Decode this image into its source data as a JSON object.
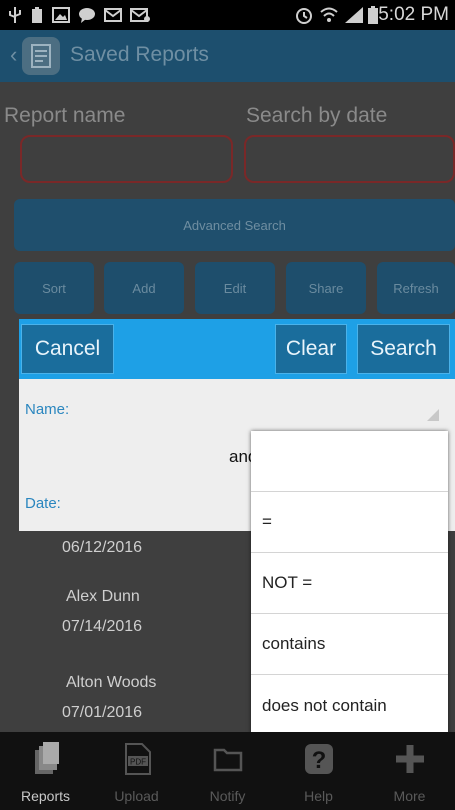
{
  "status_bar": {
    "time": "5:02 PM",
    "icons": [
      "usb-icon",
      "battery-notification-icon",
      "image-icon",
      "chat-icon",
      "gmail-icon",
      "mail-icon",
      "alarm-icon",
      "wifi-icon",
      "signal-icon",
      "battery-icon"
    ]
  },
  "action_bar": {
    "title": "Saved Reports",
    "icon": "report-icon"
  },
  "form": {
    "report_name_label": "Report name",
    "search_by_date_label": "Search by date",
    "report_name_value": "",
    "search_by_date_value": "",
    "advanced_search_label": "Advanced Search"
  },
  "toolbar": {
    "sort_label": "Sort",
    "add_label": "Add",
    "edit_label": "Edit",
    "share_label": "Share",
    "refresh_label": "Refresh"
  },
  "list": {
    "rows": [
      {
        "date": "06/12/2016"
      },
      {
        "name": "Alex Dunn",
        "date": "07/14/2016"
      },
      {
        "name": "Alton Woods",
        "date": "07/01/2016"
      }
    ]
  },
  "dialog": {
    "cancel_label": "Cancel",
    "clear_label": "Clear",
    "search_label": "Search",
    "name_label": "Name:",
    "and_label": "and",
    "date_label": "Date:"
  },
  "popup": {
    "options": [
      "",
      "=",
      "NOT =",
      "contains",
      "does not contain"
    ]
  },
  "tab_bar": {
    "tabs": [
      {
        "label": "Reports",
        "icon": "reports-icon",
        "active": true
      },
      {
        "label": "Upload",
        "icon": "pdf-icon",
        "active": false
      },
      {
        "label": "Notify",
        "icon": "folder-icon",
        "active": false
      },
      {
        "label": "Help",
        "icon": "help-icon",
        "active": false
      },
      {
        "label": "More",
        "icon": "plus-icon",
        "active": false
      }
    ]
  },
  "colors": {
    "action_bar": "#1d4f6e",
    "dialog_bar": "#1ea0e6",
    "field_border": "#7a2828",
    "dialog_label": "#2a86bf"
  }
}
